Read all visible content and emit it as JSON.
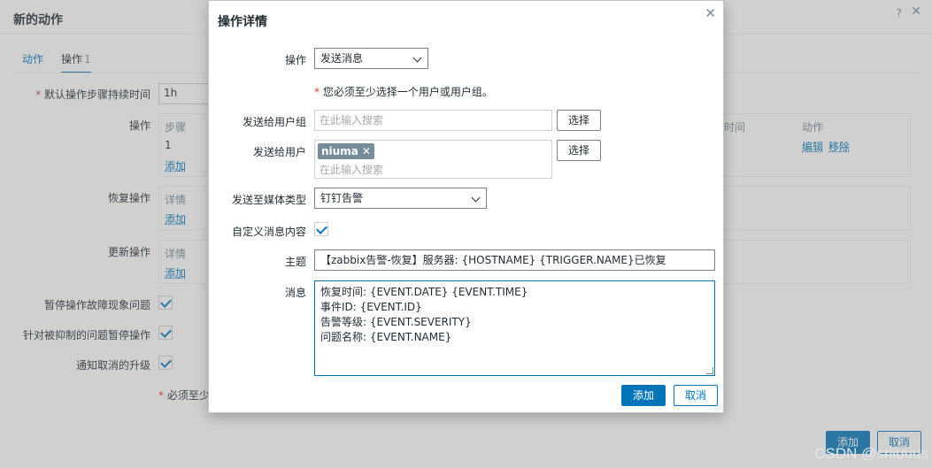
{
  "background": {
    "title": "新的动作",
    "help_glyph": "?",
    "close_glyph": "✕",
    "tabs": [
      {
        "label": "动作"
      },
      {
        "label": "操作",
        "count": "1"
      }
    ],
    "fields": {
      "default_step_duration_label": "默认操作步骤持续时间",
      "default_step_duration_value": "1h",
      "operations_label": "操作",
      "recovery_label": "恢复操作",
      "update_label": "更新操作",
      "pause_symptoms_label": "暂停操作故障现象问题",
      "pause_suppressed_label": "针对被抑制的问题暂停操作",
      "notify_cancelled_label": "通知取消的升级",
      "required_note": "必须至少"
    },
    "operations_box": {
      "col_steps": "步骤",
      "row_step": "1",
      "add_link": "添加",
      "col_time": "时间",
      "col_action": "动作",
      "edit_link": "编辑",
      "remove_link": "移除"
    },
    "recovery_box": {
      "col_details": "详情",
      "add_link": "添加"
    },
    "update_box": {
      "col_details": "详情",
      "add_link": "添加"
    },
    "buttons": {
      "add": "添加",
      "cancel": "取消"
    }
  },
  "modal": {
    "title": "操作详情",
    "close_glyph": "✕",
    "operation_label": "操作",
    "operation_value": "发送消息",
    "required_hint": "您必须至少选择一个用户或用户组。",
    "send_to_groups_label": "发送给用户组",
    "send_to_groups_placeholder": "在此输入搜索",
    "select_button": "选择",
    "send_to_users_label": "发送给用户",
    "user_tag": "niuma",
    "tag_remove_glyph": "✕",
    "send_to_users_placeholder": "在此输入搜索",
    "media_type_label": "发送至媒体类型",
    "media_type_value": "钉钉告警",
    "custom_message_label": "自定义消息内容",
    "subject_label": "主题",
    "subject_value": "【zabbix告警-恢复】服务器: {HOSTNAME} {TRIGGER.NAME}已恢复",
    "message_label": "消息",
    "message_lines": [
      "恢复时间: {EVENT.DATE} {EVENT.TIME}",
      "事件ID: {EVENT.ID}",
      "告警等级: {EVENT.SEVERITY}",
      "问题名称: {EVENT.NAME}"
    ],
    "add_button": "添加",
    "cancel_button": "取消"
  },
  "watermark": "CSDN @sriiuuus"
}
